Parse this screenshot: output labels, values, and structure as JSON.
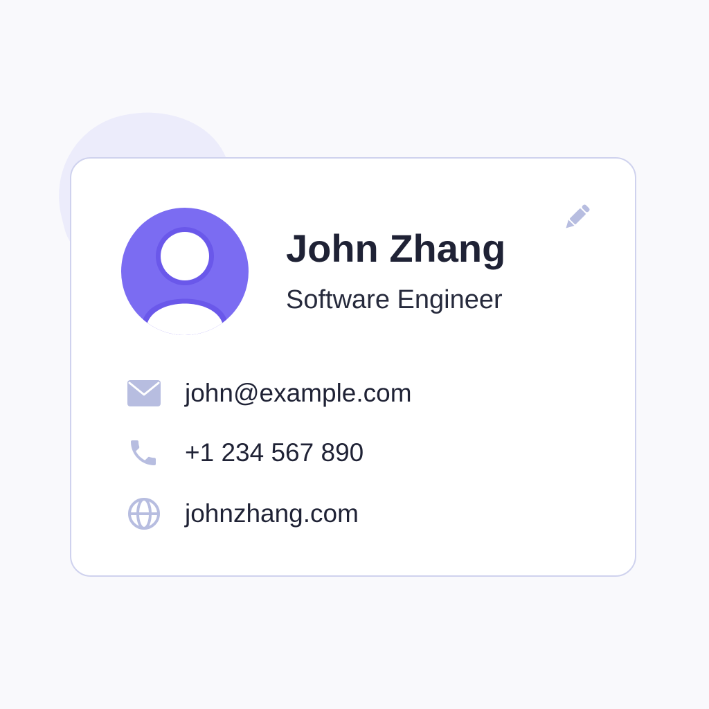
{
  "profile": {
    "name": "John Zhang",
    "title": "Software Engineer"
  },
  "contacts": {
    "email": "john@example.com",
    "phone": "+1 234 567 890",
    "website": "johnzhang.com"
  },
  "icons": {
    "edit": "pencil-icon",
    "avatar": "user-avatar-icon",
    "email": "envelope-icon",
    "phone": "phone-icon",
    "website": "globe-icon"
  },
  "colors": {
    "page_background": "#f9f9fc",
    "blob": "#ececfb",
    "card_border": "#cfd2ee",
    "accent": "#7b6cf2",
    "accent_dark": "#6a58ea",
    "icon_muted": "#b7bde0",
    "text": "#1f2235"
  }
}
